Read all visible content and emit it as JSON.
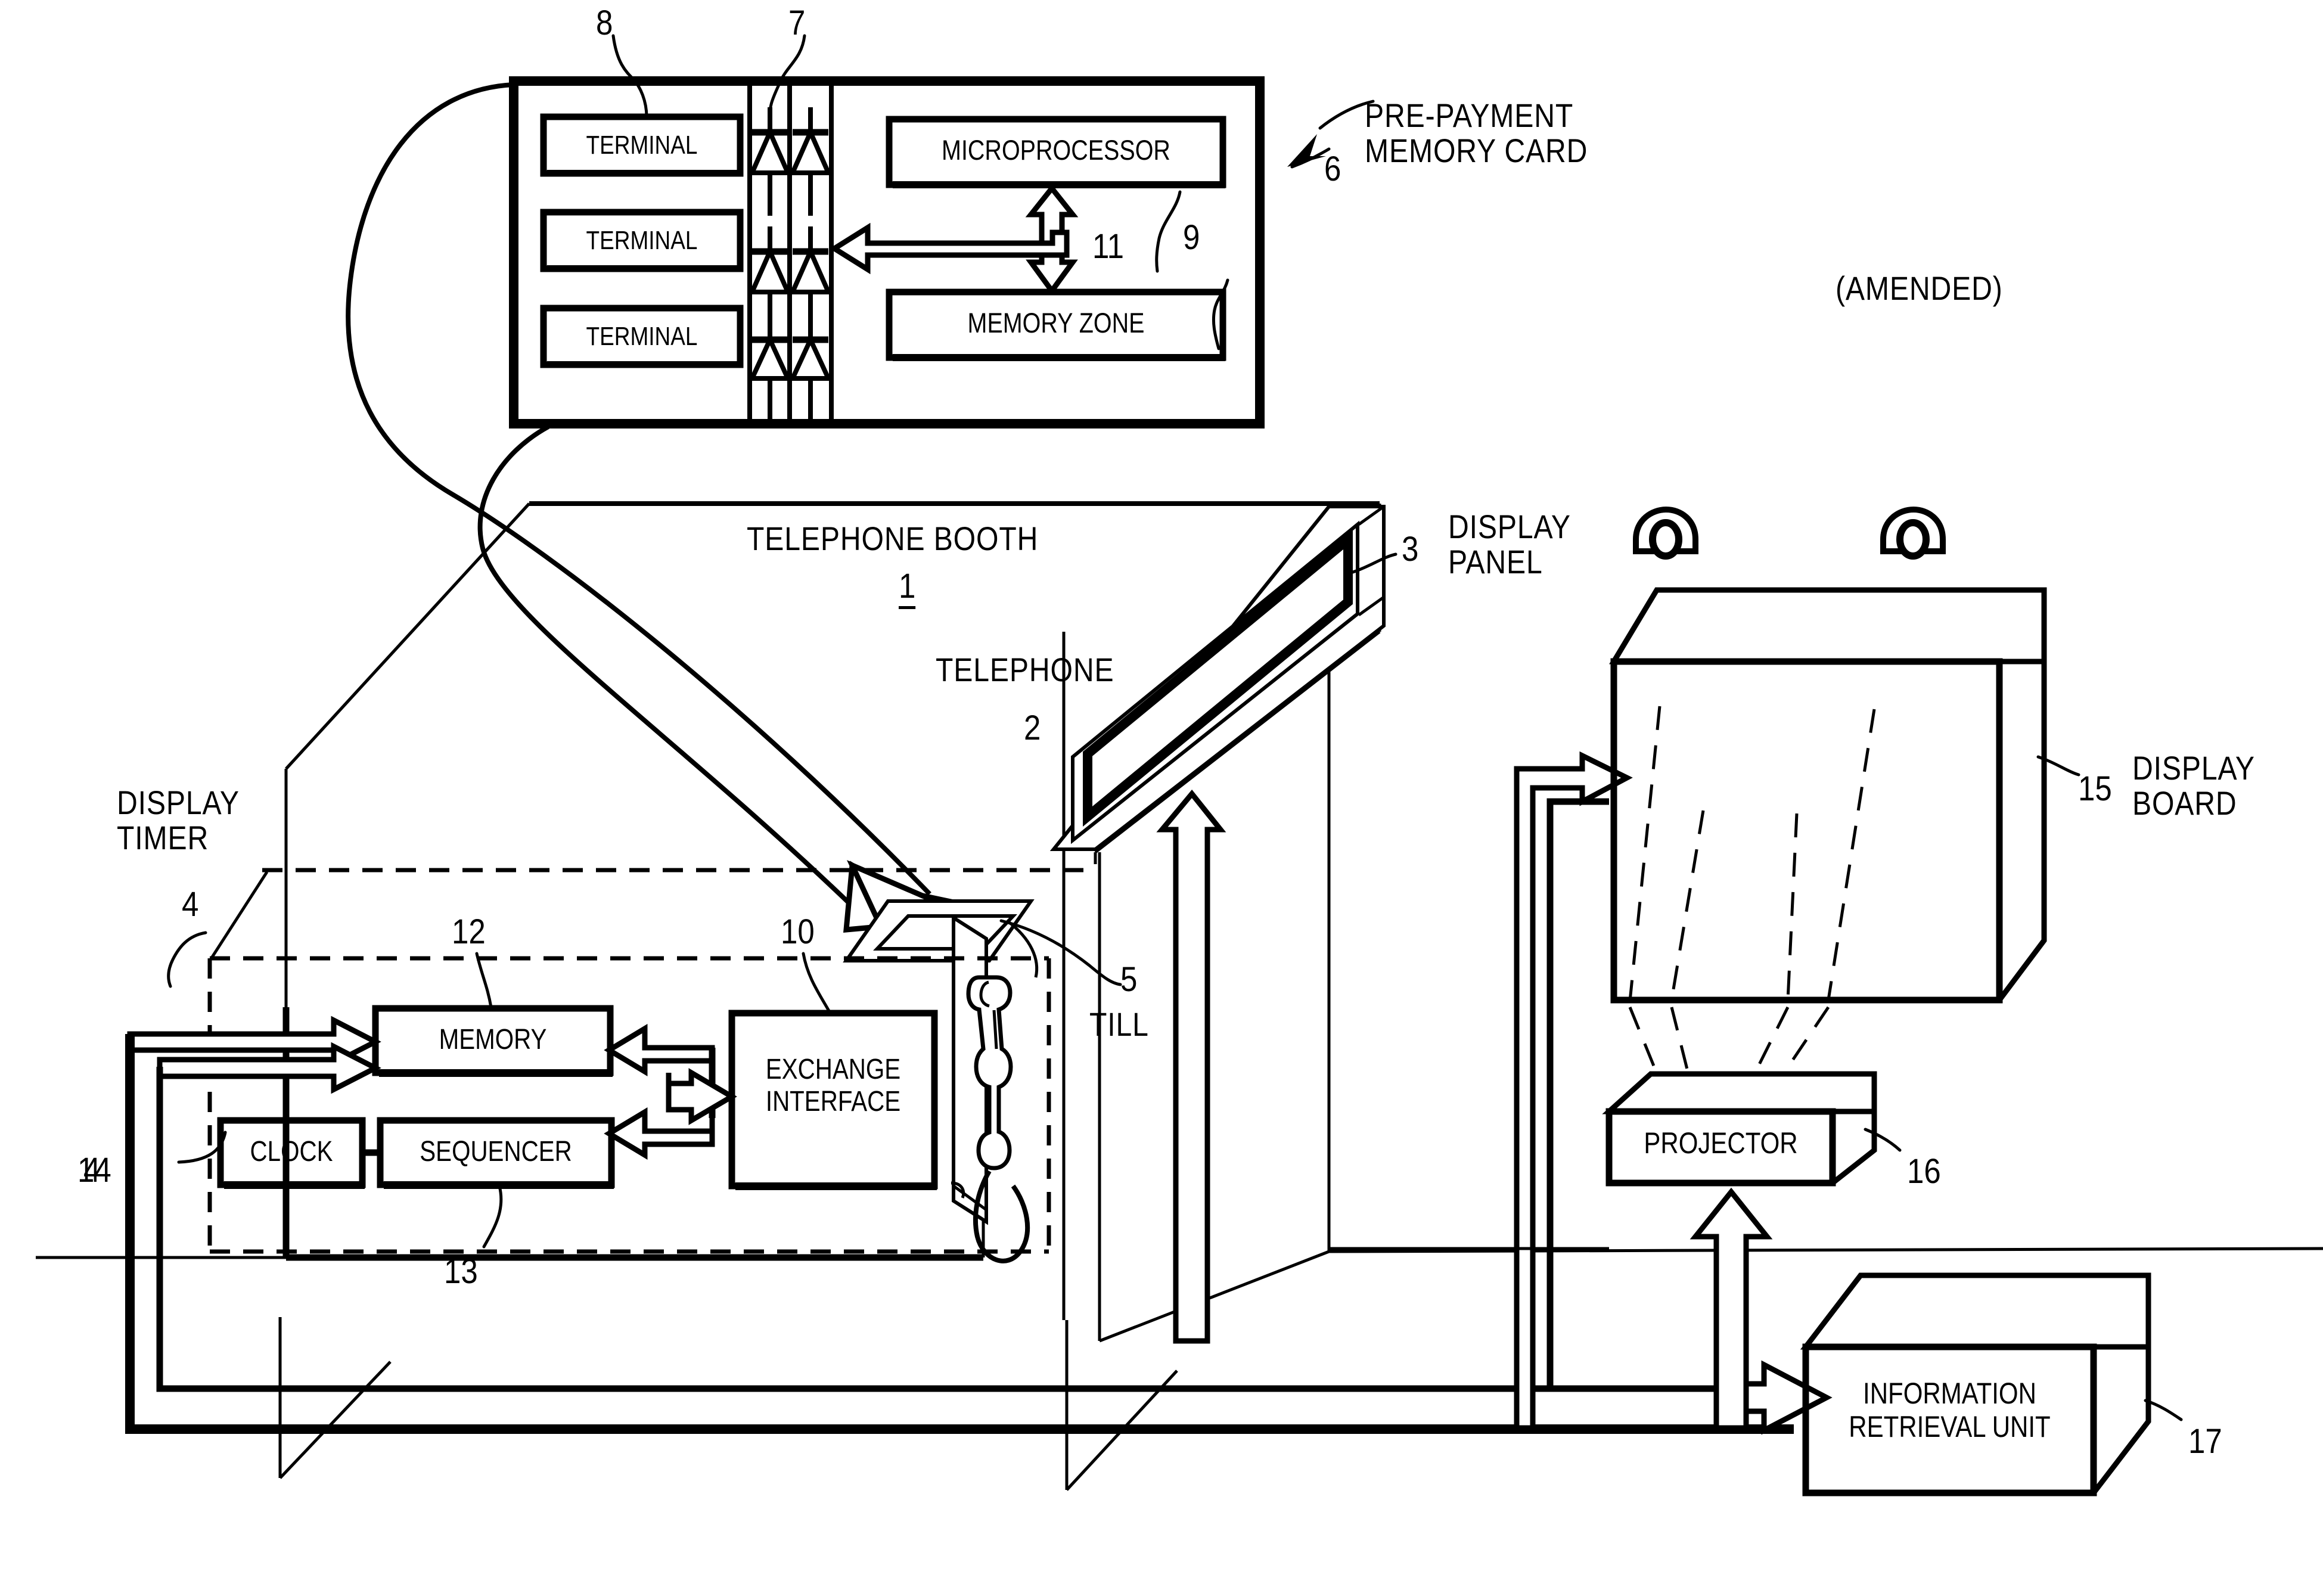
{
  "figure": {
    "title_note": "(AMENDED)",
    "annotations": {
      "pre_payment_memory_card": "PRE-PAYMENT\nMEMORY CARD",
      "telephone_booth": "TELEPHONE BOOTH",
      "telephone": "TELEPHONE",
      "display_panel": "DISPLAY\nPANEL",
      "display_board": "DISPLAY\nBOARD",
      "display_timer": "DISPLAY\nTIMER",
      "till": "TILL"
    }
  },
  "memory_card": {
    "label": "PRE-PAYMENT MEMORY CARD",
    "ref": "6",
    "terminals": [
      {
        "label": "TERMINAL",
        "ref": "8"
      },
      {
        "label": "TERMINAL",
        "ref": ""
      },
      {
        "label": "TERMINAL",
        "ref": ""
      }
    ],
    "terminal_group_ref": "8",
    "diodes_ref": "7",
    "microprocessor": {
      "label": "MICROPROCESSOR",
      "ref": "11"
    },
    "memory_zone": {
      "label": "MEMORY ZONE",
      "ref": "9"
    }
  },
  "booth": {
    "label": "TELEPHONE BOOTH",
    "ref": "1",
    "telephone": {
      "label": "TELEPHONE",
      "ref": "2"
    },
    "till": {
      "label": "TILL",
      "ref": "5"
    },
    "display_panel": {
      "label": "DISPLAY PANEL",
      "ref": "3"
    }
  },
  "display_timer": {
    "label": "DISPLAY TIMER",
    "ref": "4",
    "ref_alt": "4",
    "blocks": [
      {
        "label": "MEMORY",
        "ref": "12"
      },
      {
        "label": "CLOCK",
        "ref": "14"
      },
      {
        "label": "SEQUENCER",
        "ref": "13"
      },
      {
        "label": "EXCHANGE\nINTERFACE",
        "ref": "10"
      }
    ]
  },
  "right_side": {
    "display_board": {
      "label": "DISPLAY BOARD",
      "ref": "15"
    },
    "projector": {
      "label": "PROJECTOR",
      "ref": "16"
    },
    "information_retrieval_unit": {
      "label": "INFORMATION\nRETRIEVAL UNIT",
      "ref": "17"
    }
  },
  "refs": {
    "n1": "1",
    "n2": "2",
    "n3": "3",
    "n4": "4",
    "n4b": "4",
    "n5": "5",
    "n6": "6",
    "n7": "7",
    "n8": "8",
    "n9": "9",
    "n10": "10",
    "n11": "11",
    "n12": "12",
    "n13": "13",
    "n14": "14",
    "n15": "15",
    "n16": "16",
    "n17": "17"
  },
  "colors": {
    "ink": "#000000",
    "paper": "#ffffff"
  }
}
